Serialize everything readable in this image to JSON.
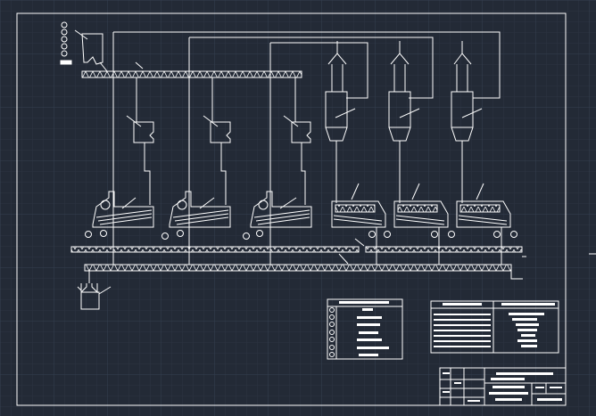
{
  "colors": {
    "background": "#232a36",
    "grid_minor": "#2c3442",
    "grid_major": "#354050",
    "line": "#ffffff"
  },
  "drawing": {
    "process_units": 6,
    "upper_collector_hatch": "xx",
    "lower_collector_hatch": "xx"
  }
}
